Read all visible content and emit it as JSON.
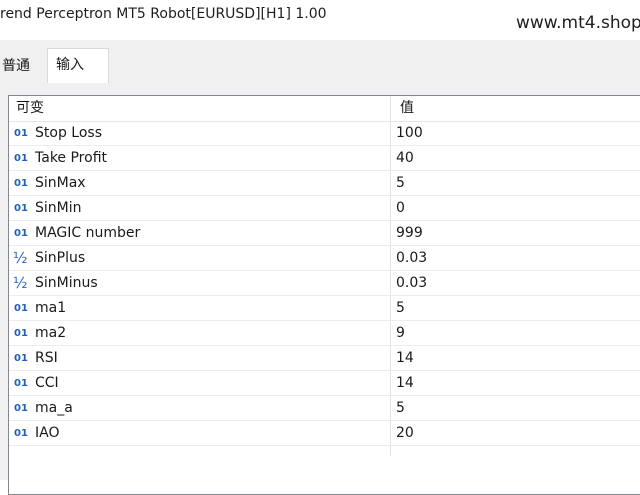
{
  "window": {
    "title": "rend Perceptron MT5 Robot[EURUSD][H1] 1.00",
    "watermark": "www.mt4.shop"
  },
  "tabs": [
    {
      "label": "普通"
    },
    {
      "label": "输入",
      "active": true
    }
  ],
  "grid": {
    "headers": {
      "variable": "可变",
      "value": "值"
    },
    "rows": [
      {
        "type": "01",
        "icon": "int-type-icon",
        "name": "Stop Loss",
        "value": "100"
      },
      {
        "type": "01",
        "icon": "int-type-icon",
        "name": "Take Profit",
        "value": "40"
      },
      {
        "type": "01",
        "icon": "int-type-icon",
        "name": "SinMax",
        "value": "5"
      },
      {
        "type": "01",
        "icon": "int-type-icon",
        "name": "SinMin",
        "value": "0"
      },
      {
        "type": "01",
        "icon": "int-type-icon",
        "name": "MAGIC number",
        "value": "999"
      },
      {
        "type": "½",
        "icon": "double-type-icon",
        "name": "SinPlus",
        "value": "0.03"
      },
      {
        "type": "½",
        "icon": "double-type-icon",
        "name": "SinMinus",
        "value": "0.03"
      },
      {
        "type": "01",
        "icon": "int-type-icon",
        "name": "ma1",
        "value": "5"
      },
      {
        "type": "01",
        "icon": "int-type-icon",
        "name": "ma2",
        "value": "9"
      },
      {
        "type": "01",
        "icon": "int-type-icon",
        "name": "RSI",
        "value": "14"
      },
      {
        "type": "01",
        "icon": "int-type-icon",
        "name": "CCI",
        "value": "14"
      },
      {
        "type": "01",
        "icon": "int-type-icon",
        "name": "ma_a",
        "value": "5"
      },
      {
        "type": "01",
        "icon": "int-type-icon",
        "name": "IAO",
        "value": "20"
      }
    ]
  }
}
